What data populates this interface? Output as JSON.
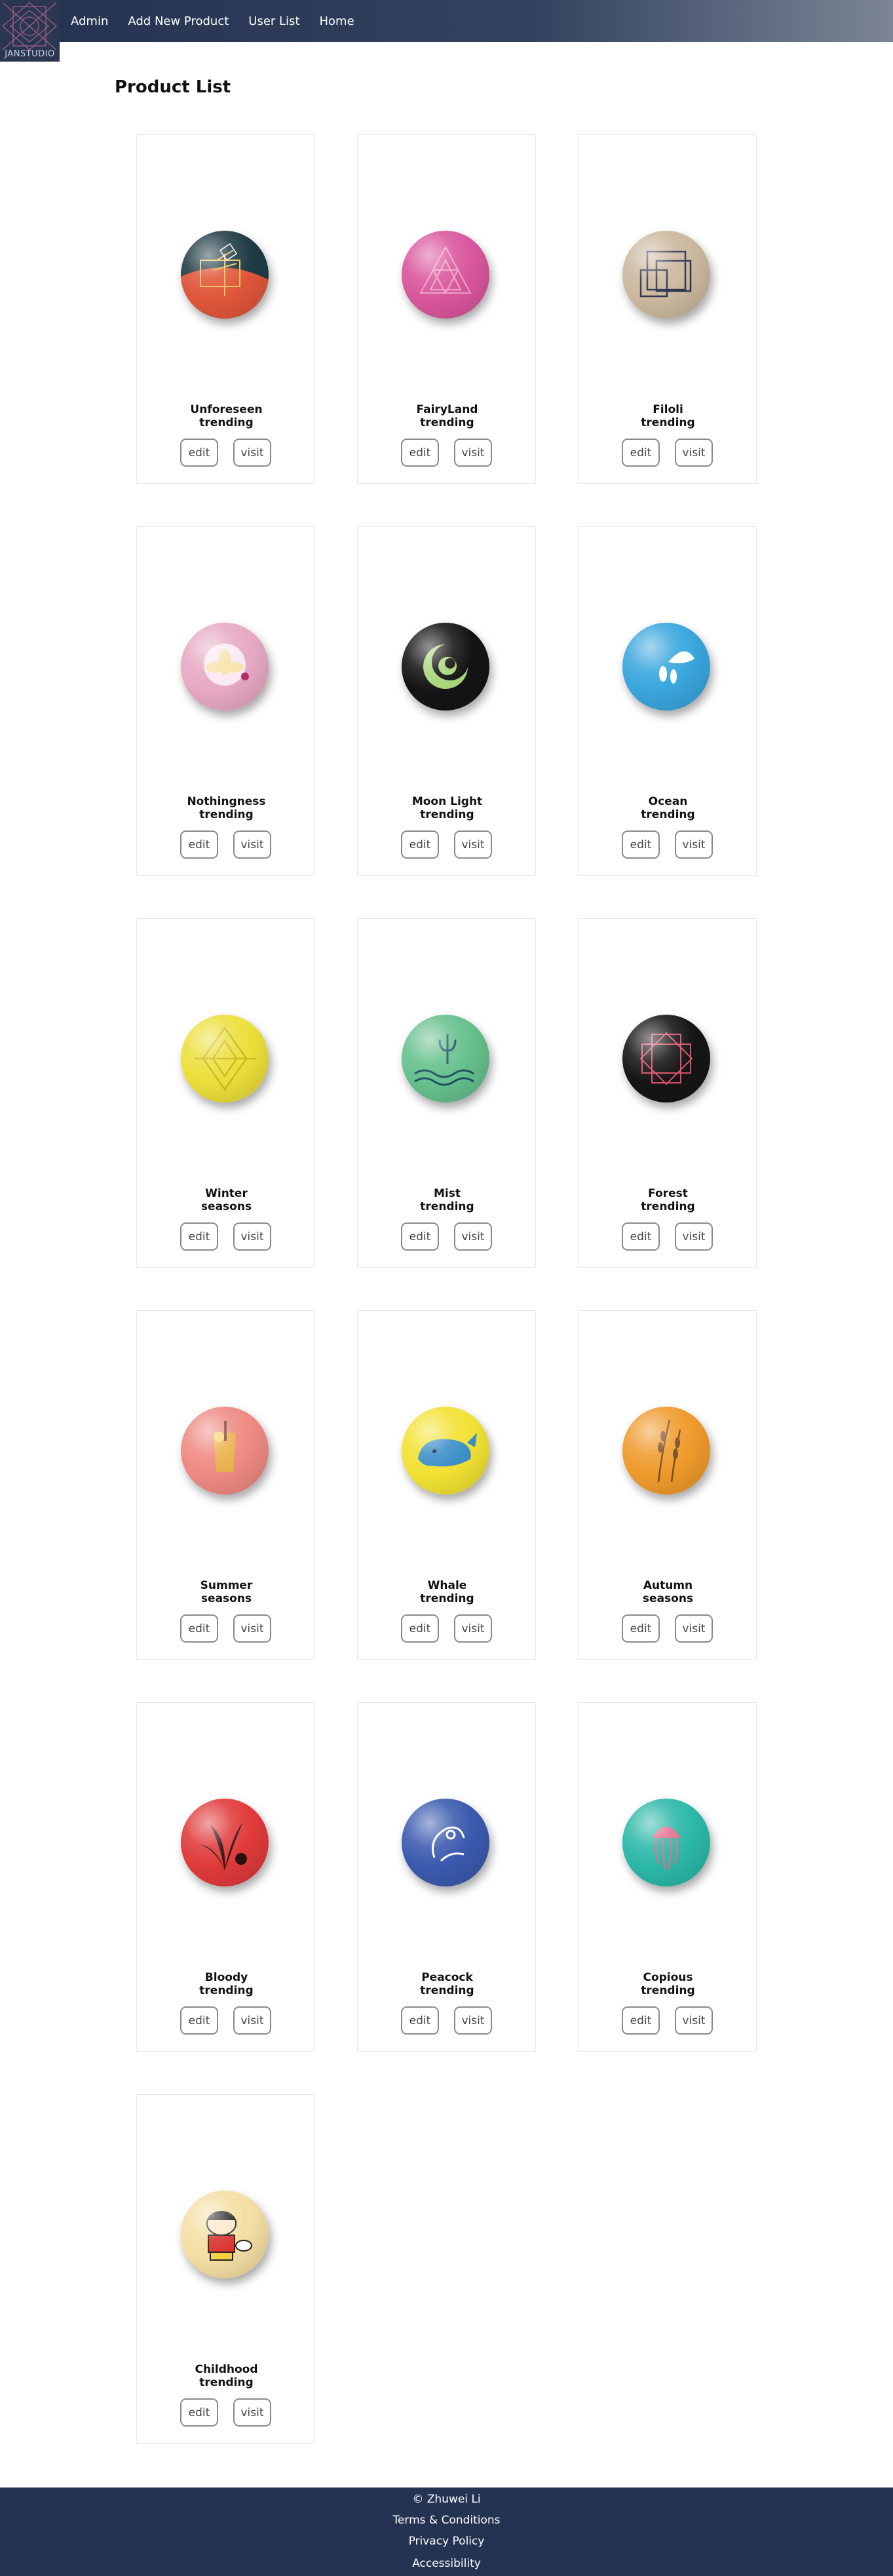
{
  "brand": {
    "logo_text": "JANSTUDIO"
  },
  "nav": {
    "links": [
      "Admin",
      "Add New Product",
      "User List",
      "Home"
    ]
  },
  "page": {
    "title": "Product List"
  },
  "buttons": {
    "edit": "edit",
    "visit": "visit"
  },
  "products": [
    {
      "name": "Unforeseen",
      "category": "trending",
      "icon": "flower-line-art-badge",
      "colors": [
        "#e0573a",
        "#1f3b45",
        "#e8c15a"
      ]
    },
    {
      "name": "FairyLand",
      "category": "trending",
      "icon": "triangle-pattern-badge",
      "colors": [
        "#d9569c",
        "#f0a3c8"
      ]
    },
    {
      "name": "Filoli",
      "category": "trending",
      "icon": "squares-badge",
      "colors": [
        "#cbb89e",
        "#2e3550"
      ]
    },
    {
      "name": "Nothingness",
      "category": "trending",
      "icon": "lotus-badge",
      "colors": [
        "#e7a9c4",
        "#f6e3a8"
      ]
    },
    {
      "name": "Moon Light",
      "category": "trending",
      "icon": "crescent-swirl-badge",
      "colors": [
        "#141414",
        "#a8d57a"
      ]
    },
    {
      "name": "Ocean",
      "category": "trending",
      "icon": "wave-drop-badge",
      "colors": [
        "#39a6dd",
        "#ffffff"
      ]
    },
    {
      "name": "Winter",
      "category": "seasons",
      "icon": "diamond-pattern-badge",
      "colors": [
        "#ecdf3a",
        "#c9b820"
      ]
    },
    {
      "name": "Mist",
      "category": "trending",
      "icon": "trident-waves-badge",
      "colors": [
        "#66c08c",
        "#1e4f66"
      ]
    },
    {
      "name": "Forest",
      "category": "trending",
      "icon": "geometric-star-badge",
      "colors": [
        "#151515",
        "#d8526a"
      ]
    },
    {
      "name": "Summer",
      "category": "seasons",
      "icon": "drink-glass-badge",
      "colors": [
        "#ee8a82",
        "#e9b04a"
      ]
    },
    {
      "name": "Whale",
      "category": "trending",
      "icon": "whale-badge",
      "colors": [
        "#f2e233",
        "#3a8dc8"
      ]
    },
    {
      "name": "Autumn",
      "category": "seasons",
      "icon": "wheat-badge",
      "colors": [
        "#ef9a2c",
        "#7a4a1c"
      ]
    },
    {
      "name": "Bloody",
      "category": "trending",
      "icon": "plant-silhouette-badge",
      "colors": [
        "#e03a3a",
        "#2a0f0f"
      ]
    },
    {
      "name": "Peacock",
      "category": "trending",
      "icon": "peacock-badge",
      "colors": [
        "#3b5aae",
        "#ffffff"
      ]
    },
    {
      "name": "Copious",
      "category": "trending",
      "icon": "jellyfish-badge",
      "colors": [
        "#2bb8a8",
        "#e36a8a"
      ]
    },
    {
      "name": "Childhood",
      "category": "trending",
      "icon": "cartoon-boy-badge",
      "colors": [
        "#f4dfa3",
        "#d9302c"
      ]
    }
  ],
  "footer": {
    "copyright": "© Zhuwei Li",
    "links": [
      "Terms & Conditions",
      "Privacy Policy",
      "Accessibility"
    ]
  }
}
